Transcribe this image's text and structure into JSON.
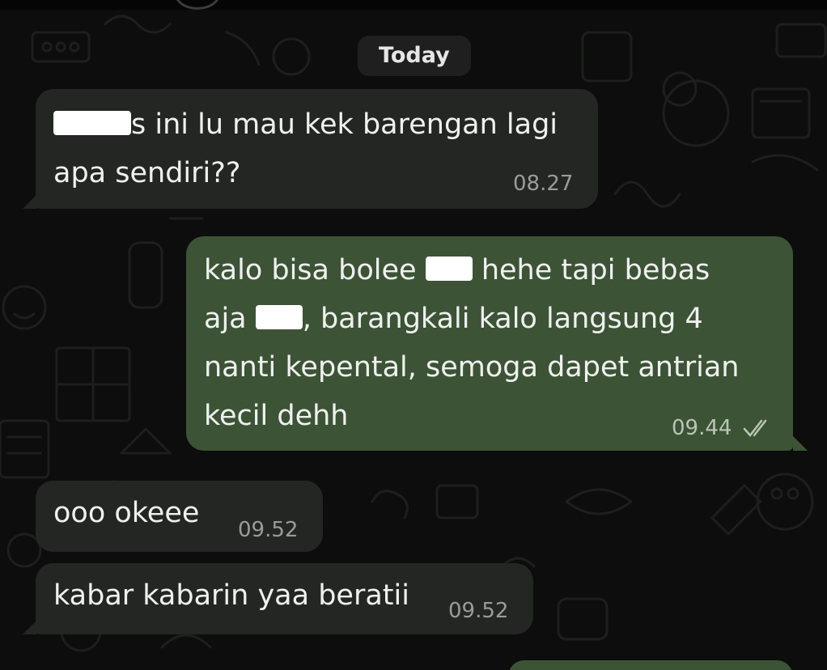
{
  "date_chip": "Today",
  "messages": [
    {
      "direction": "incoming",
      "lines": [
        "s ini lu mau kek barengan lagi",
        "apa sendiri??"
      ],
      "time": "08.27"
    },
    {
      "direction": "outgoing",
      "line1_a": "kalo bisa bolee",
      "line1_b": "hehe tapi bebas",
      "line2_a": "aja",
      "line2_b": ", barangkali kalo langsung 4",
      "line3": "nanti kepental, semoga dapet antrian",
      "line4": "kecil dehh",
      "time": "09.44",
      "status": "read-double-check"
    },
    {
      "direction": "incoming",
      "text": "ooo okeee",
      "time": "09.52"
    },
    {
      "direction": "incoming",
      "text": "kabar kabarin yaa beratii",
      "time": "09.52"
    }
  ],
  "colors": {
    "background": "#0c0d0c",
    "incoming_bubble": "#242624",
    "outgoing_bubble": "#3c5336",
    "date_chip": "#1e1f1e",
    "read_ticks": "#b9c6b4"
  }
}
